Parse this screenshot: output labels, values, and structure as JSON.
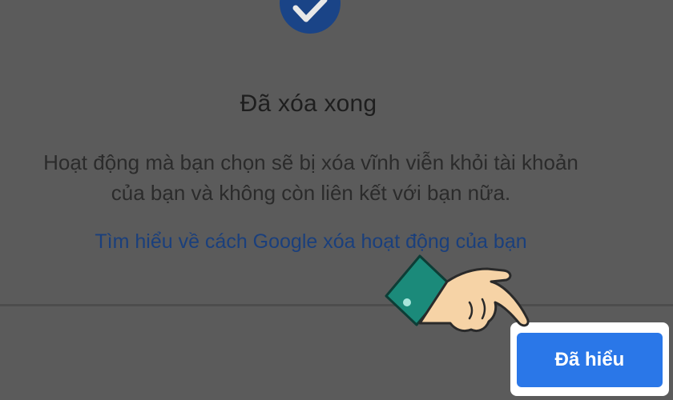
{
  "dialog": {
    "icon": "check-circle-icon",
    "title": "Đã xóa xong",
    "body_line1": "Hoạt động mà bạn chọn sẽ bị xóa vĩnh viễn khỏi tài khoản",
    "body_line2": "của bạn và không còn liên kết với bạn nữa.",
    "link": "Tìm hiểu về cách Google xóa hoạt động của bạn",
    "button": "Đã hiểu"
  },
  "colors": {
    "overlay": "#5b5b5b",
    "icon": "#1a4487",
    "link": "#1a3f7c",
    "button": "#2a77e8"
  },
  "annotation": {
    "pointer": "pointing-hand-icon"
  }
}
